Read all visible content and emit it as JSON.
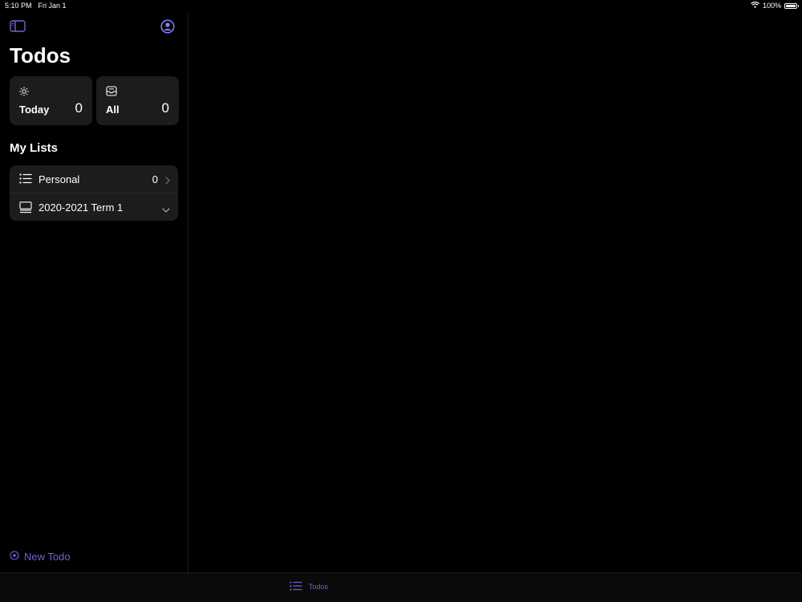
{
  "status_bar": {
    "time": "5:10 PM",
    "date": "Fri Jan 1",
    "battery": "100%",
    "battery_level": 1.0
  },
  "colors": {
    "accent": "#6e65d6",
    "background": "#000000",
    "card": "#1c1c1e"
  },
  "sidebar": {
    "toggle_icon": "sidebar-icon",
    "profile_icon": "person-circle-icon",
    "title": "Todos",
    "cards": {
      "today": {
        "icon": "sun-icon",
        "label": "Today",
        "count": "0"
      },
      "all": {
        "icon": "tray-icon",
        "label": "All",
        "count": "0"
      }
    },
    "section_title": "My Lists",
    "lists": [
      {
        "icon": "list-bullet-icon",
        "label": "Personal",
        "count": "0",
        "chevron": "chevron-right-icon"
      },
      {
        "icon": "tray-stack-icon",
        "label": "2020-2021 Term 1",
        "count": "",
        "chevron": "chevron-down-icon"
      }
    ],
    "new_todo": {
      "icon": "plus-circle-icon",
      "label": "New Todo"
    }
  },
  "tab_bar": {
    "tabs": [
      {
        "icon": "list-bullet-icon",
        "label": "Todos"
      }
    ]
  }
}
